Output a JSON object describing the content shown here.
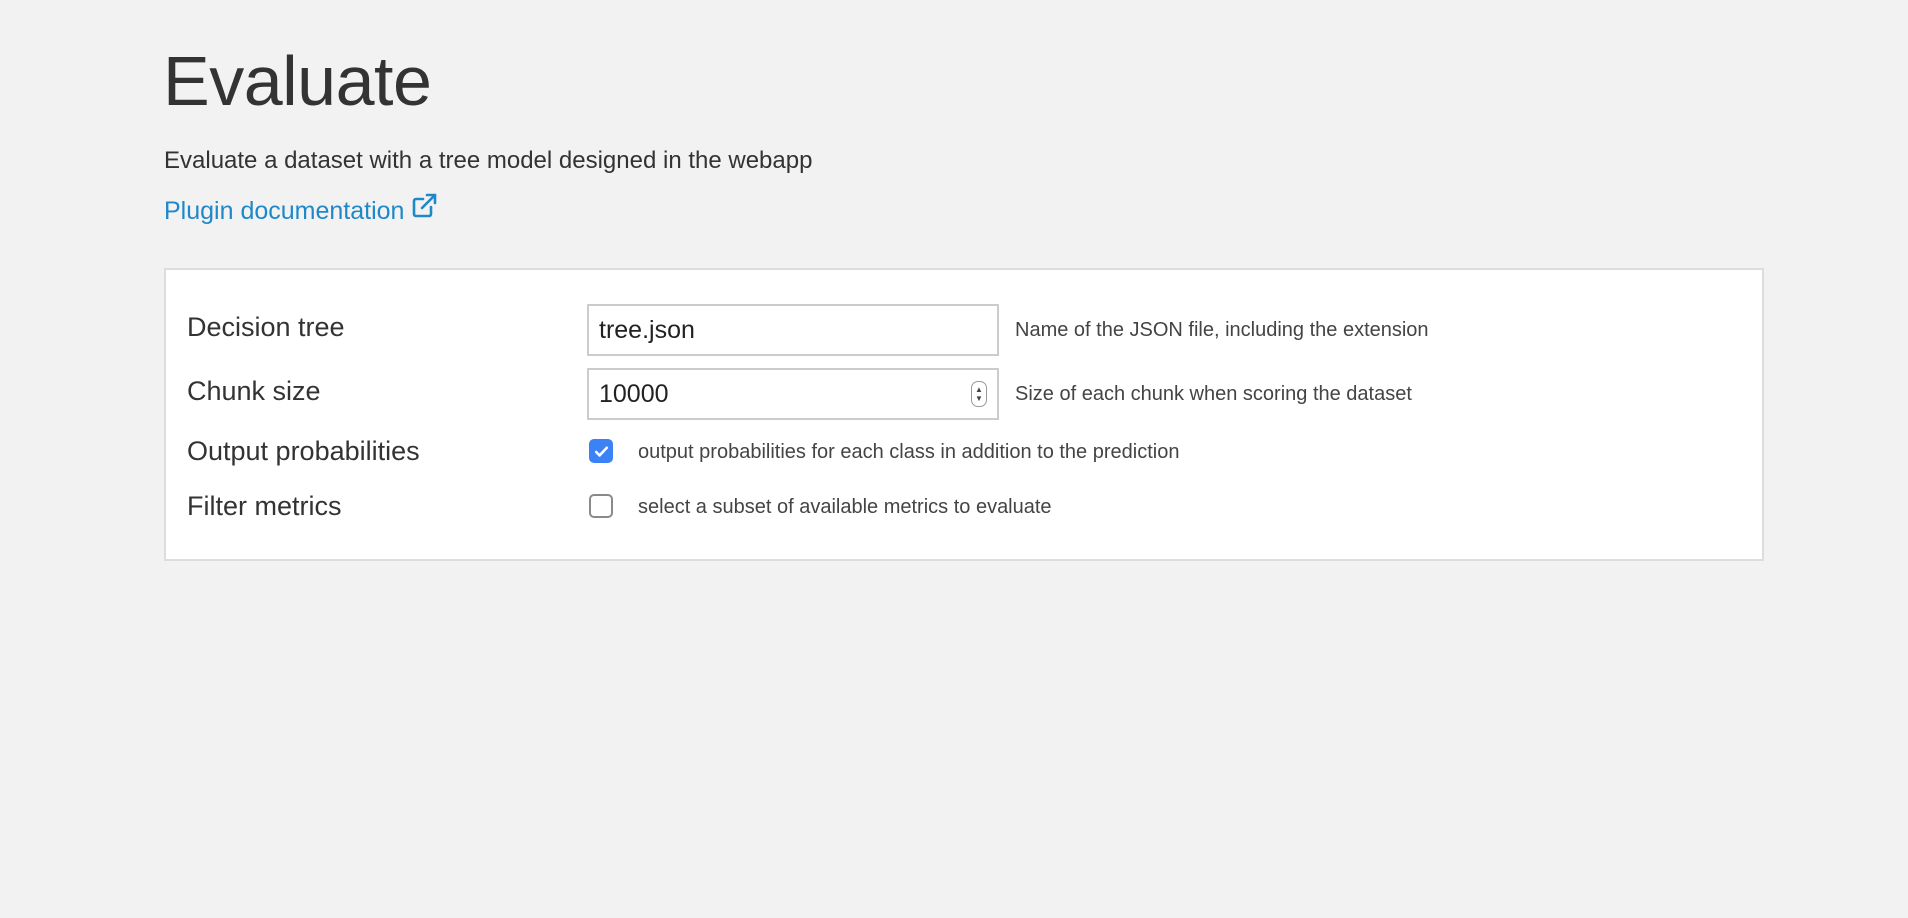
{
  "page": {
    "title": "Evaluate",
    "description": "Evaluate a dataset with a tree model designed in the webapp",
    "doc_link": {
      "label": "Plugin documentation",
      "icon": "external-link-icon"
    }
  },
  "form": {
    "decision_tree": {
      "label": "Decision tree",
      "value": "tree.json",
      "help": "Name of the JSON file, including the extension"
    },
    "chunk_size": {
      "label": "Chunk size",
      "value": "10000",
      "help": "Size of each chunk when scoring the dataset"
    },
    "output_probabilities": {
      "label": "Output probabilities",
      "checked": true,
      "text": "output probabilities for each class in addition to the prediction"
    },
    "filter_metrics": {
      "label": "Filter metrics",
      "checked": false,
      "text": "select a subset of available metrics to evaluate"
    }
  },
  "colors": {
    "background": "#f2f2f2",
    "link": "#1e88c8",
    "checkbox_checked": "#3b82f6"
  }
}
